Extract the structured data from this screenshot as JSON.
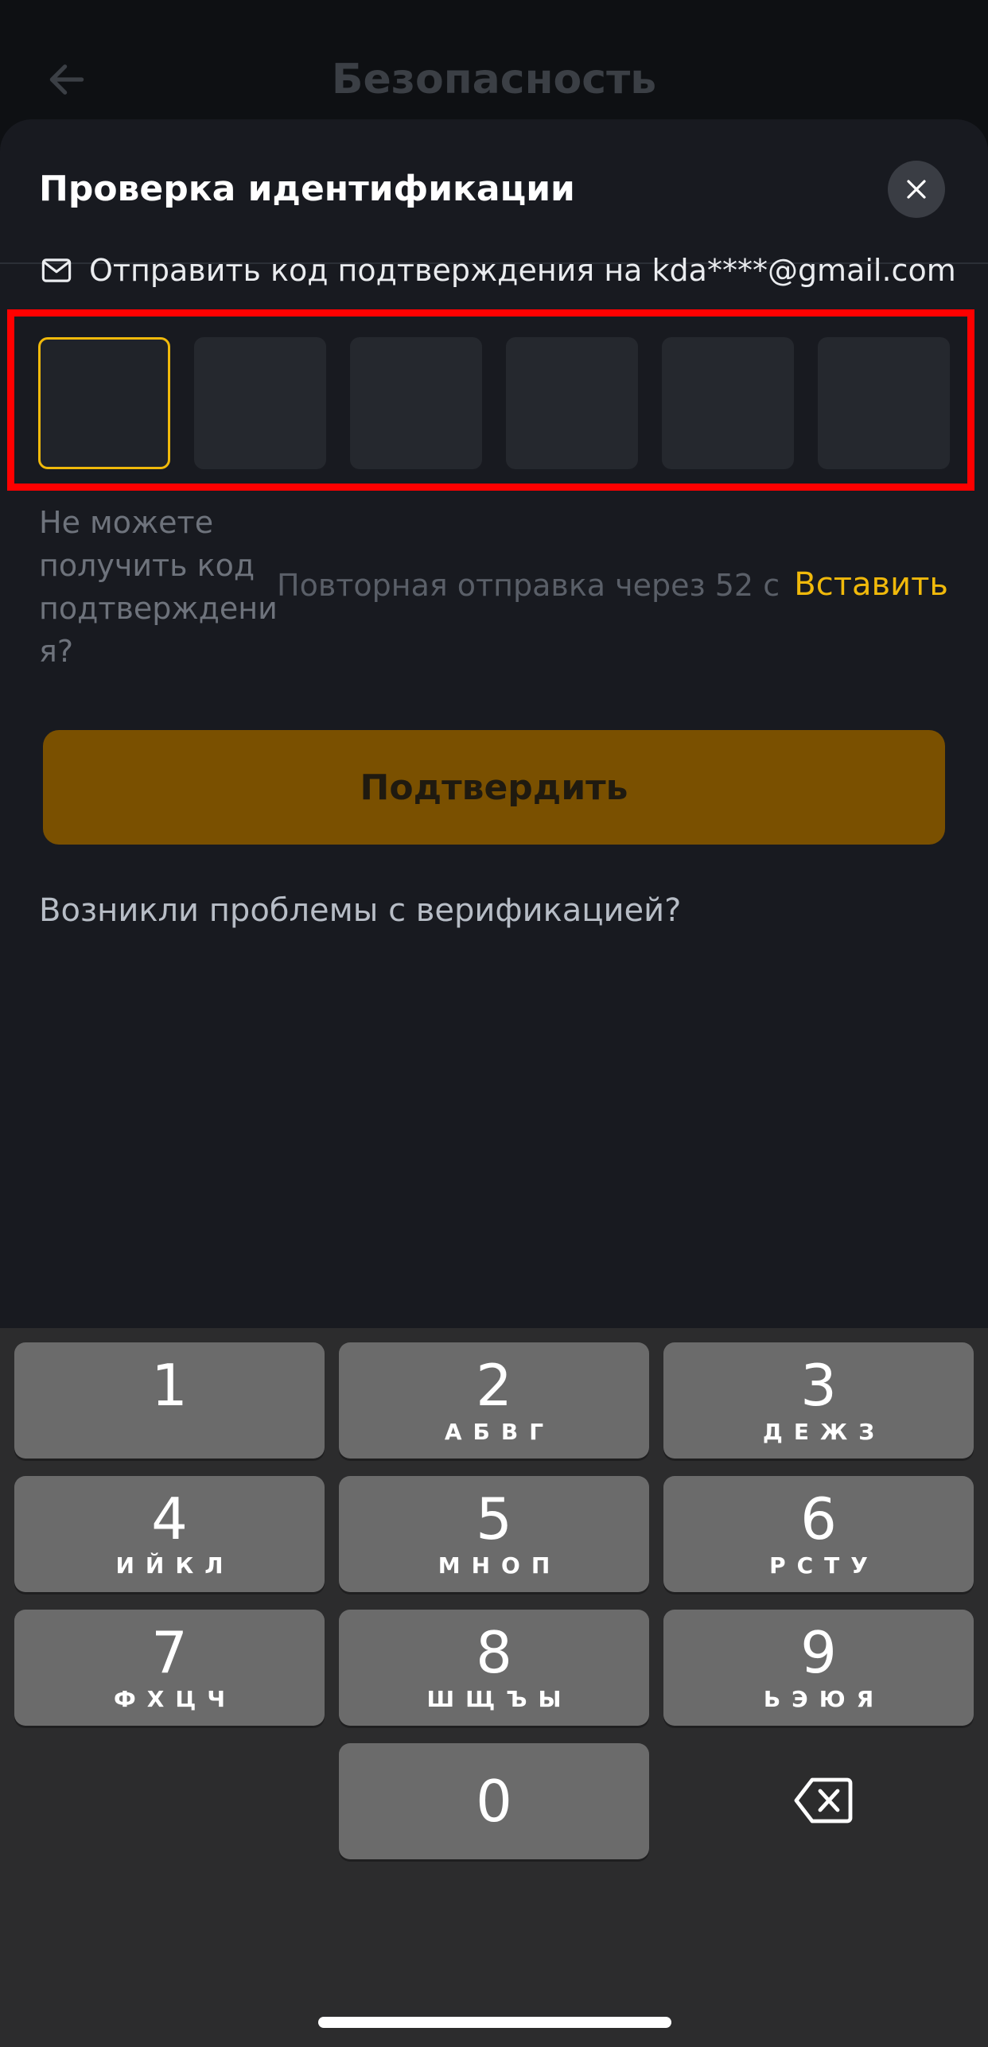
{
  "background_page": {
    "title": "Безопасность"
  },
  "sheet": {
    "title": "Проверка идентификации",
    "send_text": "Отправить код подтверждения на kda****@gmail.com",
    "code_cells": [
      "",
      "",
      "",
      "",
      "",
      ""
    ],
    "cant_receive": "Не можете получить код подтверждени я?",
    "resend": "Повторная отправка через 52 с",
    "paste": "Вставить",
    "confirm": "Подтвердить",
    "problems": "Возникли проблемы с верификацией?"
  },
  "keyboard": {
    "keys": [
      {
        "digit": "1",
        "letters": ""
      },
      {
        "digit": "2",
        "letters": "АБВГ"
      },
      {
        "digit": "3",
        "letters": "ДЕЖЗ"
      },
      {
        "digit": "4",
        "letters": "ИЙКЛ"
      },
      {
        "digit": "5",
        "letters": "МНОП"
      },
      {
        "digit": "6",
        "letters": "РСТУ"
      },
      {
        "digit": "7",
        "letters": "ФХЦЧ"
      },
      {
        "digit": "8",
        "letters": "ШЩЪЫ"
      },
      {
        "digit": "9",
        "letters": "ЬЭЮЯ"
      },
      {
        "digit": "0",
        "letters": ""
      }
    ]
  },
  "colors": {
    "accent": "#f0b90b",
    "highlight_frame": "#ff0000",
    "confirm_bg": "#7a5000"
  }
}
